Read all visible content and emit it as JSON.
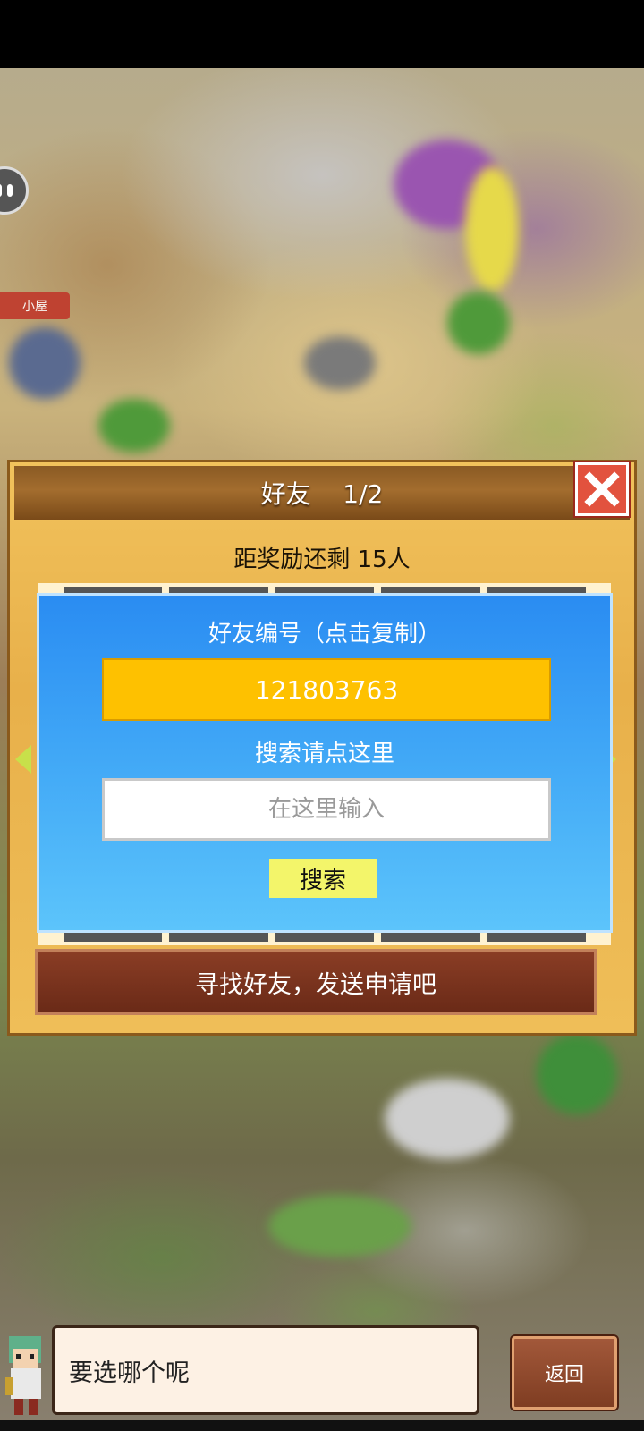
{
  "map": {
    "hut_tag": "小屋"
  },
  "panel": {
    "title": "好友    1/2",
    "reward_text": "距奖励还剩 15人",
    "friend_id_label": "好友编号（点击复制）",
    "friend_id": "121803763",
    "search_label": "搜索请点这里",
    "search_placeholder": "在这里输入",
    "search_button": "搜索",
    "find_friends_button": "寻找好友，发送申请吧"
  },
  "dialog": {
    "text": "要选哪个呢"
  },
  "back_button": "返回",
  "colors": {
    "panel_gold": "#efbe58",
    "header_brown": "#8a5a24",
    "close_red": "#e2523e",
    "card_blue": "#3fa6f6",
    "id_yellow": "#fec100",
    "search_button_yellow": "#f3f56a",
    "find_bar_brown": "#7a3320"
  },
  "icons": {
    "close": "close-x-icon",
    "prev": "arrow-left-icon",
    "next": "arrow-right-icon",
    "side": "chat-bubble-icon"
  }
}
